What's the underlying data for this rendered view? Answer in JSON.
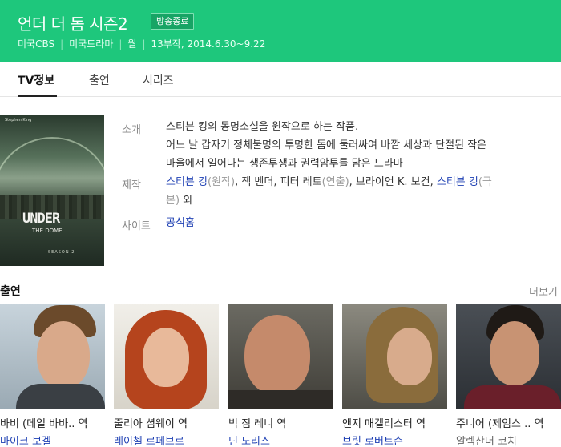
{
  "header": {
    "title": "언더 더 돔 시즌2",
    "status_badge": "방송종료",
    "meta": [
      "미국CBS",
      "미국드라마",
      "월",
      "13부작, 2014.6.30~9.22"
    ]
  },
  "tabs": [
    "TV정보",
    "출연",
    "시리즈"
  ],
  "poster": {
    "top_text": "Stephen King",
    "title_line1": "UNDER",
    "title_line2": "THE DOME",
    "season": "SEASON 2"
  },
  "info": {
    "intro_label": "소개",
    "intro_lines": [
      "스티븐 킹의 동명소설을 원작으로 하는 작품.",
      "어느 날 갑자기 정체불명의 투명한 돔에 둘러싸여 바깥 세상과 단절된 작은",
      "마을에서 일어나는 생존투쟁과 권력암투를 담은 드라마"
    ],
    "production_label": "제작",
    "production_line1": {
      "link1": "스티븐 킹",
      "note1": "(원작)",
      "text1": ", 잭 벤더, 피터 레토",
      "note2": "(연출)",
      "text2": ", 브라이언 K. 보건, ",
      "link2": "스티븐 킹",
      "note3": "(극"
    },
    "production_line2": {
      "note": "본)",
      "text": " 외"
    },
    "site_label": "사이트",
    "site_link": "공식홈"
  },
  "cast": {
    "heading": "출연",
    "more_label": "더보기",
    "members": [
      {
        "role": "바비 (데일 바바..",
        "role_suffix": "역",
        "actor": "마이크 보겔",
        "actor_link": true
      },
      {
        "role": "줄리아 셤웨이",
        "role_suffix": "역",
        "actor": "레이첼 르페브르",
        "actor_link": true
      },
      {
        "role": "빅 짐 레니",
        "role_suffix": "역",
        "actor": "딘 노리스",
        "actor_link": true
      },
      {
        "role": "앤지 매켈리스터",
        "role_suffix": "역",
        "actor": "브릿 로버트슨",
        "actor_link": true
      },
      {
        "role": "주니어 (제임스 ..",
        "role_suffix": "역",
        "actor": "알렉산더 코치",
        "actor_link": false
      }
    ]
  },
  "colors": {
    "header_bg": "#1ec77c",
    "link": "#1d3fb3"
  }
}
